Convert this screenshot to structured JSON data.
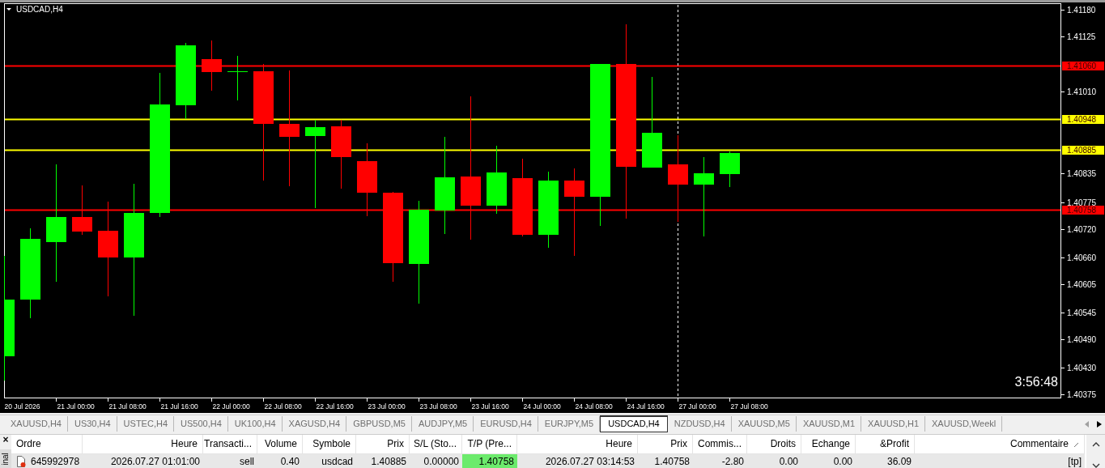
{
  "chart": {
    "title": "USDCAD,H4",
    "countdown": "3:56:48",
    "price_labels": [
      "1.41180",
      "1.41125",
      "1.41010",
      "1.40835",
      "1.40775",
      "1.40720",
      "1.40660",
      "1.40605",
      "1.40545",
      "1.40490",
      "1.40430",
      "1.40375"
    ],
    "price_lines": [
      {
        "label": "1.41060",
        "color": "#ff0000"
      },
      {
        "label": "1.40948",
        "color": "#ffff00"
      },
      {
        "label": "1.40885",
        "color": "#ffff00"
      },
      {
        "label": "1.40758",
        "color": "#ff0000"
      }
    ],
    "time_labels": [
      "20 Jul 2026",
      "21 Jul 00:00",
      "21 Jul 08:00",
      "21 Jul 16:00",
      "22 Jul 00:00",
      "22 Jul 08:00",
      "22 Jul 16:00",
      "23 Jul 00:00",
      "23 Jul 08:00",
      "23 Jul 16:00",
      "24 Jul 00:00",
      "24 Jul 08:00",
      "24 Jul 16:00",
      "27 Jul 00:00",
      "27 Jul 08:00"
    ]
  },
  "tabs": [
    {
      "label": "XAUUSD,H4",
      "selected": false
    },
    {
      "label": "US30,H4",
      "selected": false
    },
    {
      "label": "USTEC,H4",
      "selected": false
    },
    {
      "label": "US500,H4",
      "selected": false
    },
    {
      "label": "UK100,H4",
      "selected": false
    },
    {
      "label": "XAGUSD,H4",
      "selected": false
    },
    {
      "label": "GBPUSD,M5",
      "selected": false
    },
    {
      "label": "AUDJPY,M5",
      "selected": false
    },
    {
      "label": "EURUSD,H4",
      "selected": false
    },
    {
      "label": "EURJPY,M5",
      "selected": false
    },
    {
      "label": "USDCAD,H4",
      "selected": true
    },
    {
      "label": "NZDUSD,H4",
      "selected": false
    },
    {
      "label": "XAUUSD,M5",
      "selected": false
    },
    {
      "label": "XAUUSD,M1",
      "selected": false
    },
    {
      "label": "XAUUSD,H1",
      "selected": false
    },
    {
      "label": "XAUUSD,Weekl",
      "selected": false
    }
  ],
  "terminal": {
    "close_label": "×",
    "side_label": "inal",
    "columns": [
      {
        "label": "Ordre",
        "sorted": false
      },
      {
        "label": "Heure",
        "sorted": false
      },
      {
        "label": "Transacti...",
        "sorted": false
      },
      {
        "label": "Volume",
        "sorted": false
      },
      {
        "label": "Symbole",
        "sorted": false
      },
      {
        "label": "Prix",
        "sorted": false
      },
      {
        "label": "S/L (Sto...",
        "sorted": false
      },
      {
        "label": "T/P (Pre...",
        "sorted": false
      },
      {
        "label": "Heure",
        "sorted": false
      },
      {
        "label": "Prix",
        "sorted": false
      },
      {
        "label": "Commis...",
        "sorted": false
      },
      {
        "label": "Droits",
        "sorted": false
      },
      {
        "label": "Echange",
        "sorted": false
      },
      {
        "label": "&Profit",
        "sorted": false
      },
      {
        "label": "Commentaire",
        "sorted": true
      }
    ],
    "rows": [
      {
        "cells": [
          {
            "text": "645992978",
            "highlighted": false
          },
          {
            "text": "2026.07.27 01:01:00",
            "highlighted": false
          },
          {
            "text": "sell",
            "highlighted": false
          },
          {
            "text": "0.40",
            "highlighted": false
          },
          {
            "text": "usdcad",
            "highlighted": false
          },
          {
            "text": "1.40885",
            "highlighted": false
          },
          {
            "text": "0.00000",
            "highlighted": false
          },
          {
            "text": "1.40758",
            "highlighted": true
          },
          {
            "text": "2026.07.27 03:14:53",
            "highlighted": false
          },
          {
            "text": "1.40758",
            "highlighted": false
          },
          {
            "text": "-2.80",
            "highlighted": false
          },
          {
            "text": "0.00",
            "highlighted": false
          },
          {
            "text": "0.00",
            "highlighted": false
          },
          {
            "text": "36.09",
            "highlighted": false
          },
          {
            "text": "[tp]",
            "highlighted": false
          }
        ]
      }
    ]
  }
}
